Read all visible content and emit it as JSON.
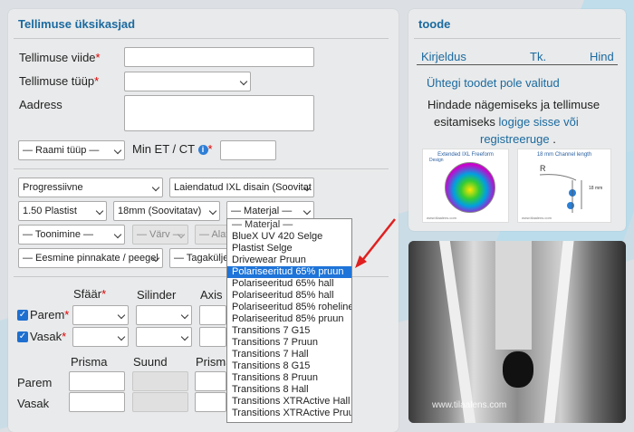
{
  "order_panel": {
    "title": "Tellimuse üksikasjad",
    "reference_label": "Tellimuse viide",
    "type_label": "Tellimuse tüüp",
    "address_label": "Aadress",
    "required_mark": "*",
    "frame_type": "— Raami tüüp —",
    "min_et_ct_label": "Min ET / CT",
    "info_icon": "i"
  },
  "lens_options": {
    "design_type": "Progressiivne",
    "design": "Laiendatud IXL disain (Soovitat",
    "material_index": "1.50 Plastist",
    "channel": "18mm (Soovitatav)",
    "material": "— Materjal —",
    "tint": "— Toonimine —",
    "tint_color": "— Värv —",
    "tint_extra": "— Alat",
    "front_coating": "— Eesmine pinnakate / peegel",
    "back_coating": "— Tagakülje p"
  },
  "prescription": {
    "sphere_label": "Sfäär",
    "cylinder_label": "Silinder",
    "axis_label": "Axis",
    "right_label": "Parem",
    "left_label": "Vasak",
    "prism_label": "Prisma",
    "direction_label": "Suund",
    "prism2_label": "Prisma",
    "checkmark": "✓"
  },
  "material_dropdown": {
    "options": [
      "— Materjal —",
      "BlueX UV 420 Selge",
      "Plastist Selge",
      "Drivewear Pruun",
      "Polariseeritud 65% pruun",
      "Polariseeritud 65% hall",
      "Polariseeritud 85% hall",
      "Polariseeritud 85% roheline",
      "Polariseeritud 85% pruun",
      "Transitions 7 G15",
      "Transitions 7 Pruun",
      "Transitions 7 Hall",
      "Transitions 8 G15",
      "Transitions 8 Pruun",
      "Transitions 8 Hall",
      "Transitions XTRActive Hall",
      "Transitions XTRActive Pruun"
    ],
    "selected": "Polariseeritud 65% pruun"
  },
  "product_panel": {
    "title": "toode",
    "col_description": "Kirjeldus",
    "col_qty": "Tk.",
    "col_price": "Hind",
    "empty_text": "Ühtegi toodet pole valitud",
    "login_text_1": "Hindade nägemiseks ja tellimuse",
    "login_text_2": "esitamiseks",
    "login_link": "logige sisse",
    "or_text": "või",
    "register_link": "registreeruge",
    "period": ".",
    "thumb1_title": "Extended IXL Freeform",
    "thumb1_sub": "Design",
    "thumb2_title": "18 mm Channel length",
    "thumb2_letter": "R",
    "thumb2_dim": "18 mm",
    "watermark": "www.tilaalens.com"
  },
  "photo": {
    "watermark": "www.tilaalens.com"
  },
  "colors": {
    "accent": "#1a6a9f",
    "selected": "#1e74d8",
    "required": "#e00000",
    "annotation_arrow": "#e02020"
  }
}
